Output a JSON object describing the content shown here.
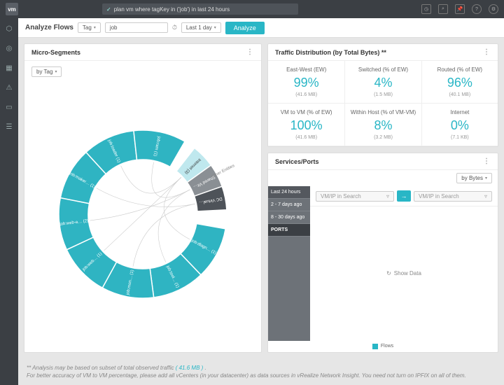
{
  "topbar": {
    "logo_text": "vm",
    "search_value": "plan vm where tagKey in ('job') in last 24 hours"
  },
  "filterbar": {
    "title": "Analyze Flows",
    "selector1": "Tag",
    "selector2_value": "job",
    "time_label": "Last 1 day",
    "analyze_btn": "Analyze"
  },
  "microsegments": {
    "title": "Micro-Segments",
    "bytag": "by Tag",
    "segments_teal": [
      "job:dlagn… (1)",
      "job:tool… (1)",
      "job:mon… (1)",
      "job:web… (1)",
      "job:web-a… (2)",
      "job:maker… (1)",
      "job:loader (1)",
      "job:ram (1)"
    ],
    "segments_other": [
      {
        "label": "Internet (3)",
        "shade": "light"
      },
      {
        "label": "Shared Vir… ",
        "shade": "mid"
      },
      {
        "label": "DC Virtual…",
        "shade": "dark"
      }
    ],
    "side_label": "Other Entities"
  },
  "traffic": {
    "title": "Traffic Distribution (by Total Bytes) **",
    "metrics": [
      {
        "title": "East-West (EW)",
        "value": "99%",
        "sub": "(41.6 MB)"
      },
      {
        "title": "Switched (% of EW)",
        "value": "4%",
        "sub": "(1.5 MB)"
      },
      {
        "title": "Routed (% of EW)",
        "value": "96%",
        "sub": "(40.1 MB)"
      },
      {
        "title": "VM to VM (% of EW)",
        "value": "100%",
        "sub": "(41.6 MB)"
      },
      {
        "title": "Within Host (% of VM-VM)",
        "value": "8%",
        "sub": "(3.2 MB)"
      },
      {
        "title": "Internet",
        "value": "0%",
        "sub": "(7.1 KB)"
      }
    ]
  },
  "services": {
    "title": "Services/Ports",
    "bybytes": "by Bytes",
    "select_placeholder": "VM/IP in Search",
    "timeranges": [
      "Last 24 hours",
      "2 - 7 days ago",
      "8 - 30 days ago"
    ],
    "ports_label": "PORTS",
    "show_data": "Show Data",
    "legend": "Flows"
  },
  "footer": {
    "line1_a": "** Analysis may be based on subset of total observed traffic ",
    "line1_link": "( 41.6 MB )",
    "line1_b": ".",
    "line2": "For better accuracy of VM to VM percentage, please add all vCenters (in your datacenter) as data sources in vRealize Network Insight. You need not turn on IPFIX on all of them."
  },
  "chart_data": {
    "type": "pie",
    "title": "Micro-Segments by Tag",
    "series": [
      {
        "name": "job:dlagn… (1)",
        "value": 1,
        "group": "job"
      },
      {
        "name": "job:tool… (1)",
        "value": 1,
        "group": "job"
      },
      {
        "name": "job:mon… (1)",
        "value": 1,
        "group": "job"
      },
      {
        "name": "job:web… (1)",
        "value": 1,
        "group": "job"
      },
      {
        "name": "job:web-a… (2)",
        "value": 1,
        "group": "job"
      },
      {
        "name": "job:maker… (1)",
        "value": 1,
        "group": "job"
      },
      {
        "name": "job:loader (1)",
        "value": 1,
        "group": "job"
      },
      {
        "name": "job:ram (1)",
        "value": 1,
        "group": "job"
      },
      {
        "name": "Internet (3)",
        "value": 1,
        "group": "other"
      },
      {
        "name": "Shared Vir…",
        "value": 1,
        "group": "other"
      },
      {
        "name": "DC Virtual…",
        "value": 1,
        "group": "other"
      }
    ]
  }
}
